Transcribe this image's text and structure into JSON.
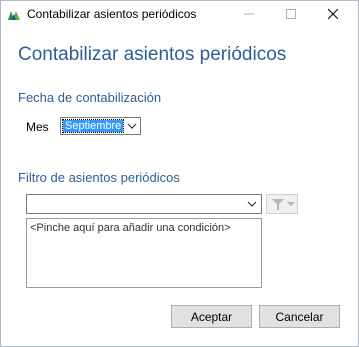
{
  "window": {
    "title": "Contabilizar asientos periódicos",
    "icon": "app-logo-icon"
  },
  "heading": "Contabilizar asientos periódicos",
  "fecha_section": {
    "title": "Fecha de contabilización",
    "mes_label": "Mes",
    "mes_value": "Septiembre"
  },
  "filtro_section": {
    "title": "Filtro de asientos periódicos",
    "combo_value": "",
    "condition_hint": "<Pinche aquí para añadir una condición>"
  },
  "buttons": {
    "accept": "Aceptar",
    "cancel": "Cancelar"
  },
  "colors": {
    "heading": "#2e5f94",
    "selection": "#3399ff"
  }
}
